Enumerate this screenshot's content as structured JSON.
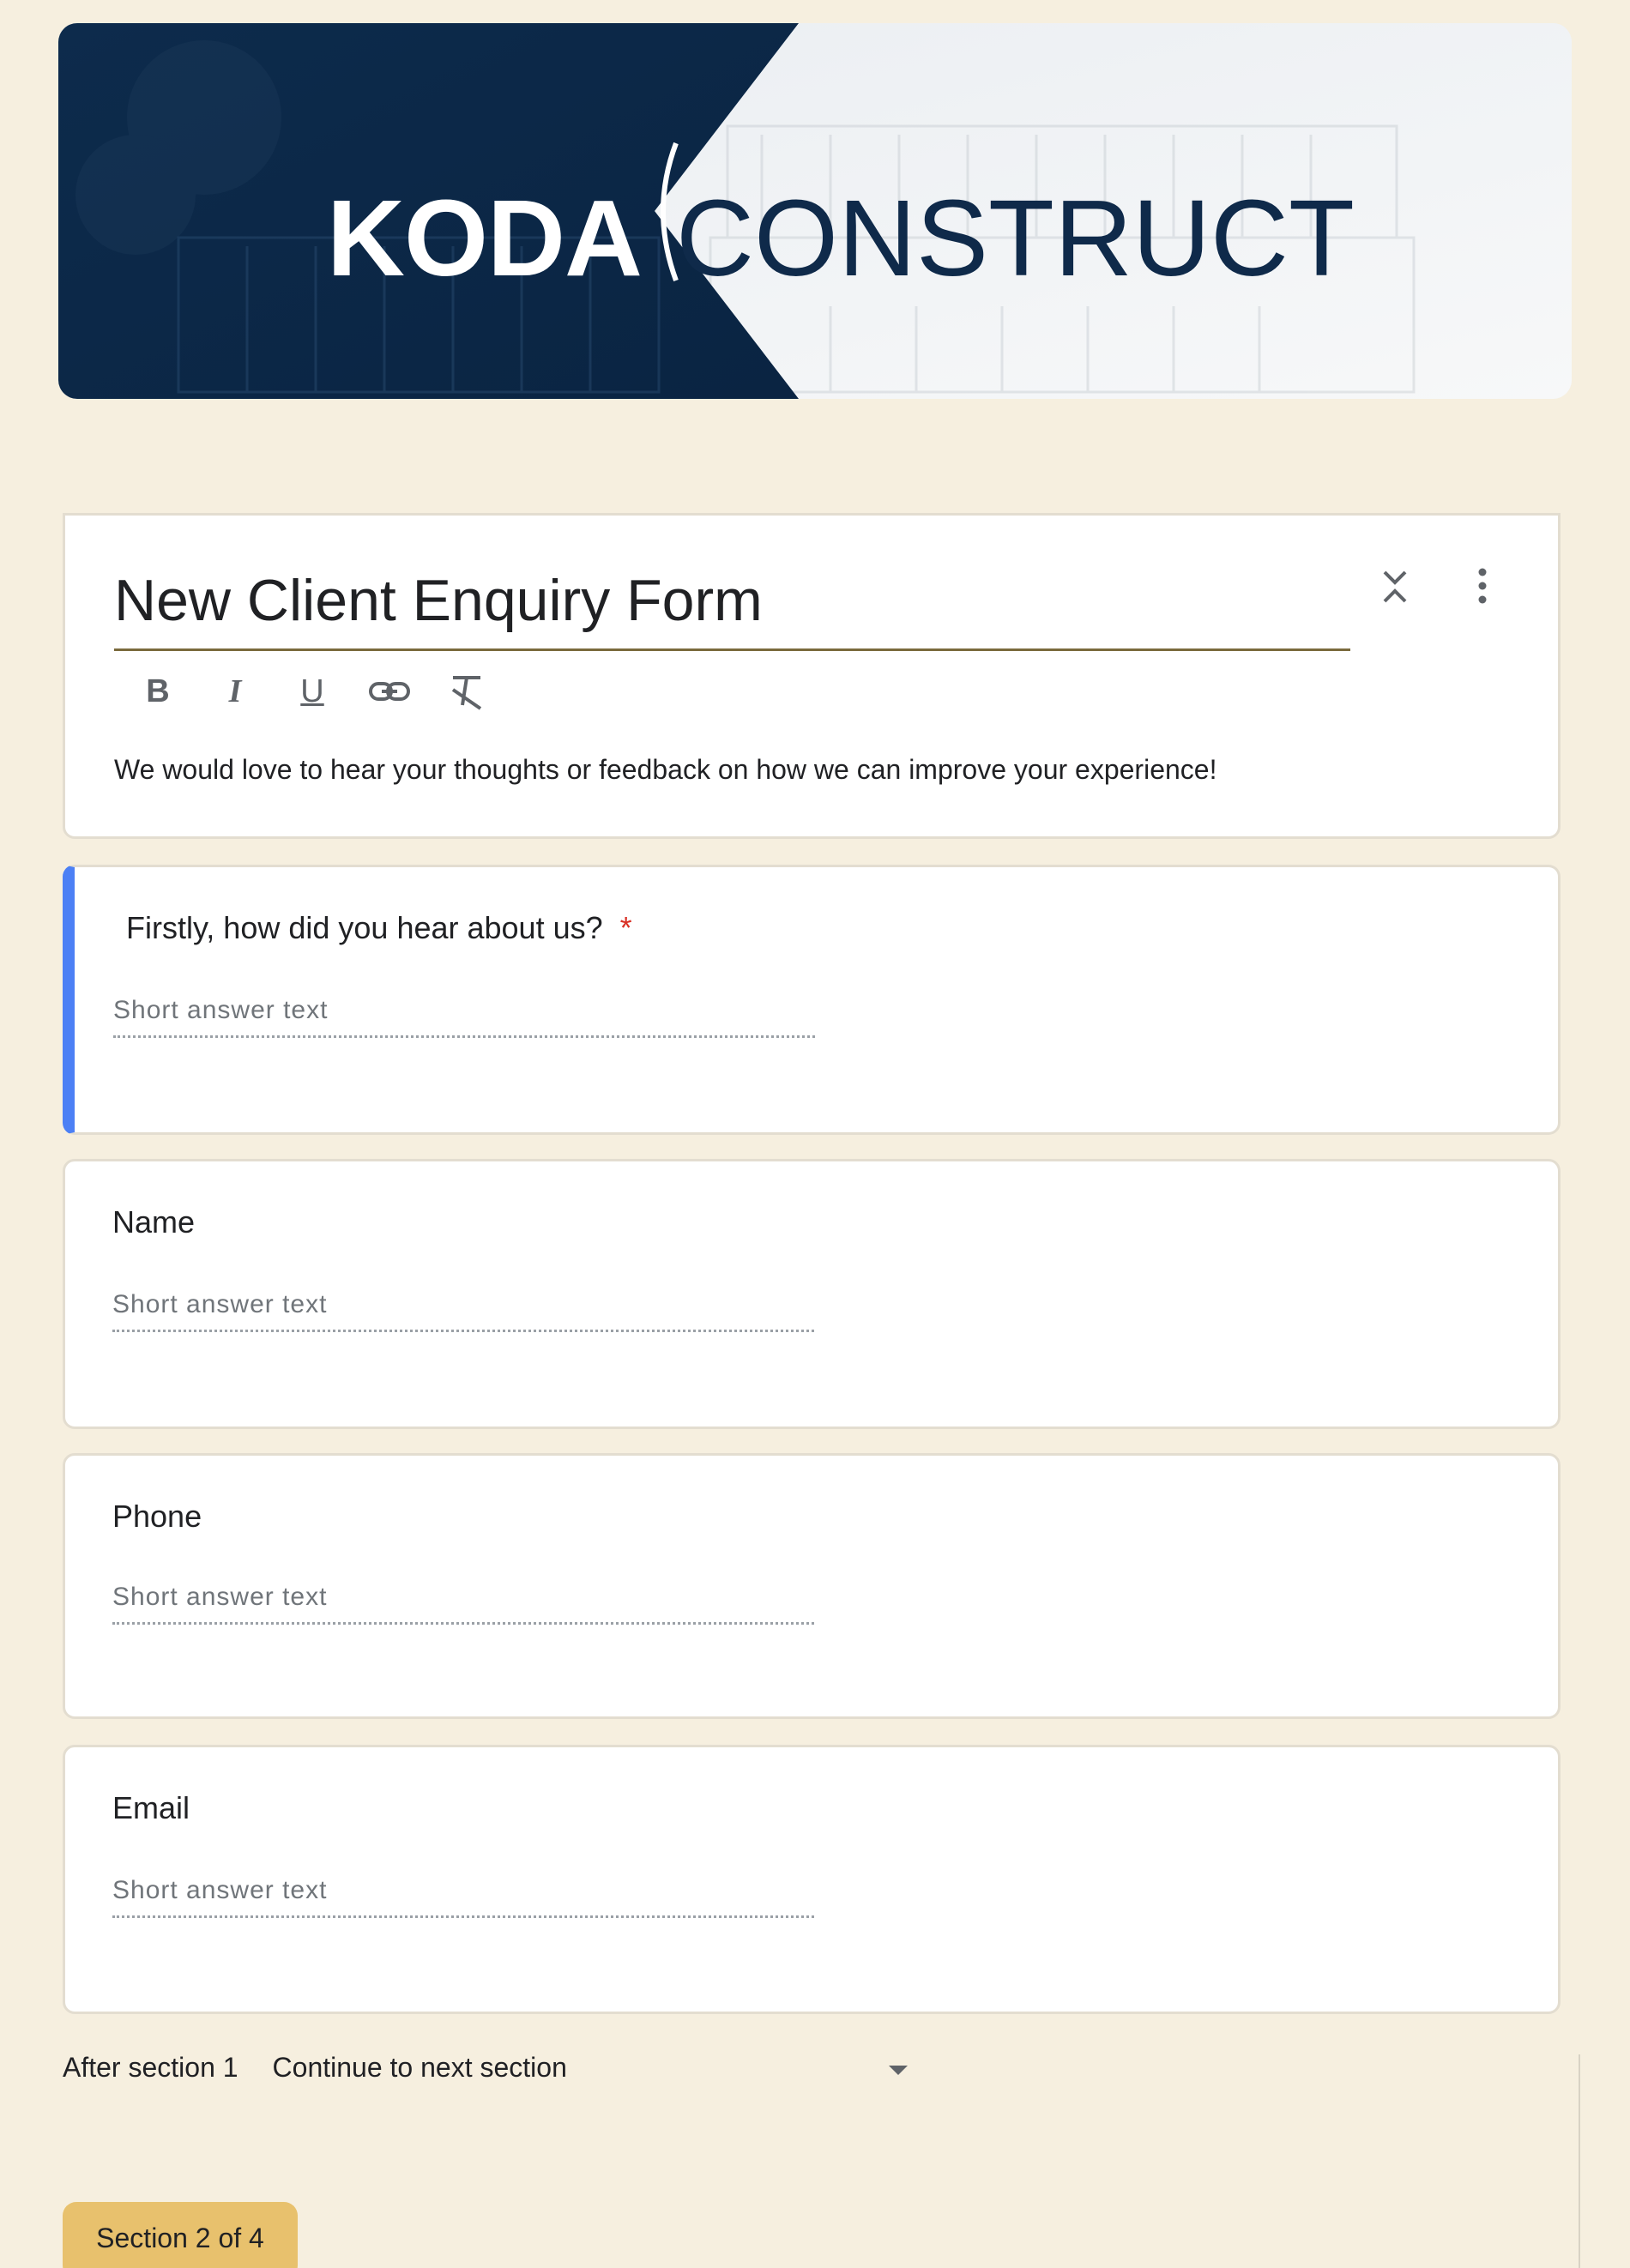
{
  "banner": {
    "brand_left": "KODA",
    "brand_right": "CONSTRUCT",
    "colors": {
      "navy": "#0f2a4a",
      "white": "#ffffff"
    }
  },
  "form": {
    "title": "New Client Enquiry Form",
    "description": "We would love to hear your thoughts or feedback on how we can improve your experience!",
    "toolbar": {
      "bold": "B",
      "italic": "I",
      "underline": "U"
    }
  },
  "questions": [
    {
      "label": "Firstly, how did you hear about us?",
      "required": "*",
      "placeholder": "Short answer text"
    },
    {
      "label": "Name",
      "placeholder": "Short answer text"
    },
    {
      "label": "Phone",
      "placeholder": "Short answer text"
    },
    {
      "label": "Email",
      "placeholder": "Short answer text"
    }
  ],
  "after_section": {
    "label": "After section 1",
    "value": "Continue to next section"
  },
  "section_badge": "Section 2 of 4",
  "colors": {
    "page_bg": "#f6efdf",
    "accent": "#4c80f5",
    "badge": "#e8c16d",
    "required": "#d93025"
  }
}
